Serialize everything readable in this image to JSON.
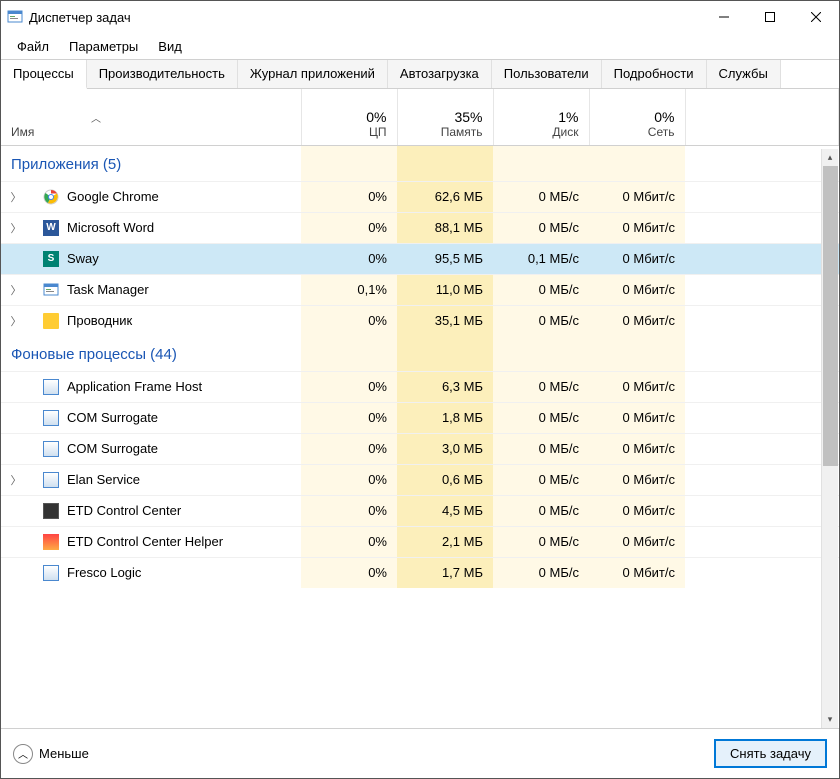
{
  "window": {
    "title": "Диспетчер задач"
  },
  "menu": {
    "file": "Файл",
    "options": "Параметры",
    "view": "Вид"
  },
  "tabs": {
    "processes": "Процессы",
    "performance": "Производительность",
    "app_history": "Журнал приложений",
    "startup": "Автозагрузка",
    "users": "Пользователи",
    "details": "Подробности",
    "services": "Службы"
  },
  "columns": {
    "name": "Имя",
    "cpu_pct": "0%",
    "cpu_label": "ЦП",
    "mem_pct": "35%",
    "mem_label": "Память",
    "disk_pct": "1%",
    "disk_label": "Диск",
    "net_pct": "0%",
    "net_label": "Сеть"
  },
  "groups": {
    "apps": "Приложения (5)",
    "background": "Фоновые процессы (44)"
  },
  "rows": {
    "apps": [
      {
        "name": "Google Chrome",
        "cpu": "0%",
        "mem": "62,6 МБ",
        "disk": "0 МБ/с",
        "net": "0 Мбит/с",
        "icon": "chrome",
        "expandable": true
      },
      {
        "name": "Microsoft Word",
        "cpu": "0%",
        "mem": "88,1 МБ",
        "disk": "0 МБ/с",
        "net": "0 Мбит/с",
        "icon": "word",
        "expandable": true
      },
      {
        "name": "Sway",
        "cpu": "0%",
        "mem": "95,5 МБ",
        "disk": "0,1 МБ/с",
        "net": "0 Мбит/с",
        "icon": "sway",
        "expandable": false,
        "selected": true
      },
      {
        "name": "Task Manager",
        "cpu": "0,1%",
        "mem": "11,0 МБ",
        "disk": "0 МБ/с",
        "net": "0 Мбит/с",
        "icon": "tm",
        "expandable": true
      },
      {
        "name": "Проводник",
        "cpu": "0%",
        "mem": "35,1 МБ",
        "disk": "0 МБ/с",
        "net": "0 Мбит/с",
        "icon": "explorer",
        "expandable": true
      }
    ],
    "bg": [
      {
        "name": "Application Frame Host",
        "cpu": "0%",
        "mem": "6,3 МБ",
        "disk": "0 МБ/с",
        "net": "0 Мбит/с",
        "icon": "generic",
        "expandable": false
      },
      {
        "name": "COM Surrogate",
        "cpu": "0%",
        "mem": "1,8 МБ",
        "disk": "0 МБ/с",
        "net": "0 Мбит/с",
        "icon": "generic",
        "expandable": false
      },
      {
        "name": "COM Surrogate",
        "cpu": "0%",
        "mem": "3,0 МБ",
        "disk": "0 МБ/с",
        "net": "0 Мбит/с",
        "icon": "generic",
        "expandable": false
      },
      {
        "name": "Elan Service",
        "cpu": "0%",
        "mem": "0,6 МБ",
        "disk": "0 МБ/с",
        "net": "0 Мбит/с",
        "icon": "generic",
        "expandable": true
      },
      {
        "name": "ETD Control Center",
        "cpu": "0%",
        "mem": "4,5 МБ",
        "disk": "0 МБ/с",
        "net": "0 Мбит/с",
        "icon": "etd",
        "expandable": false
      },
      {
        "name": "ETD Control Center Helper",
        "cpu": "0%",
        "mem": "2,1 МБ",
        "disk": "0 МБ/с",
        "net": "0 Мбит/с",
        "icon": "etd-h",
        "expandable": false
      },
      {
        "name": "Fresco Logic",
        "cpu": "0%",
        "mem": "1,7 МБ",
        "disk": "0 МБ/с",
        "net": "0 Мбит/с",
        "icon": "generic",
        "expandable": false
      }
    ]
  },
  "footer": {
    "less": "Меньше",
    "end_task": "Снять задачу"
  }
}
